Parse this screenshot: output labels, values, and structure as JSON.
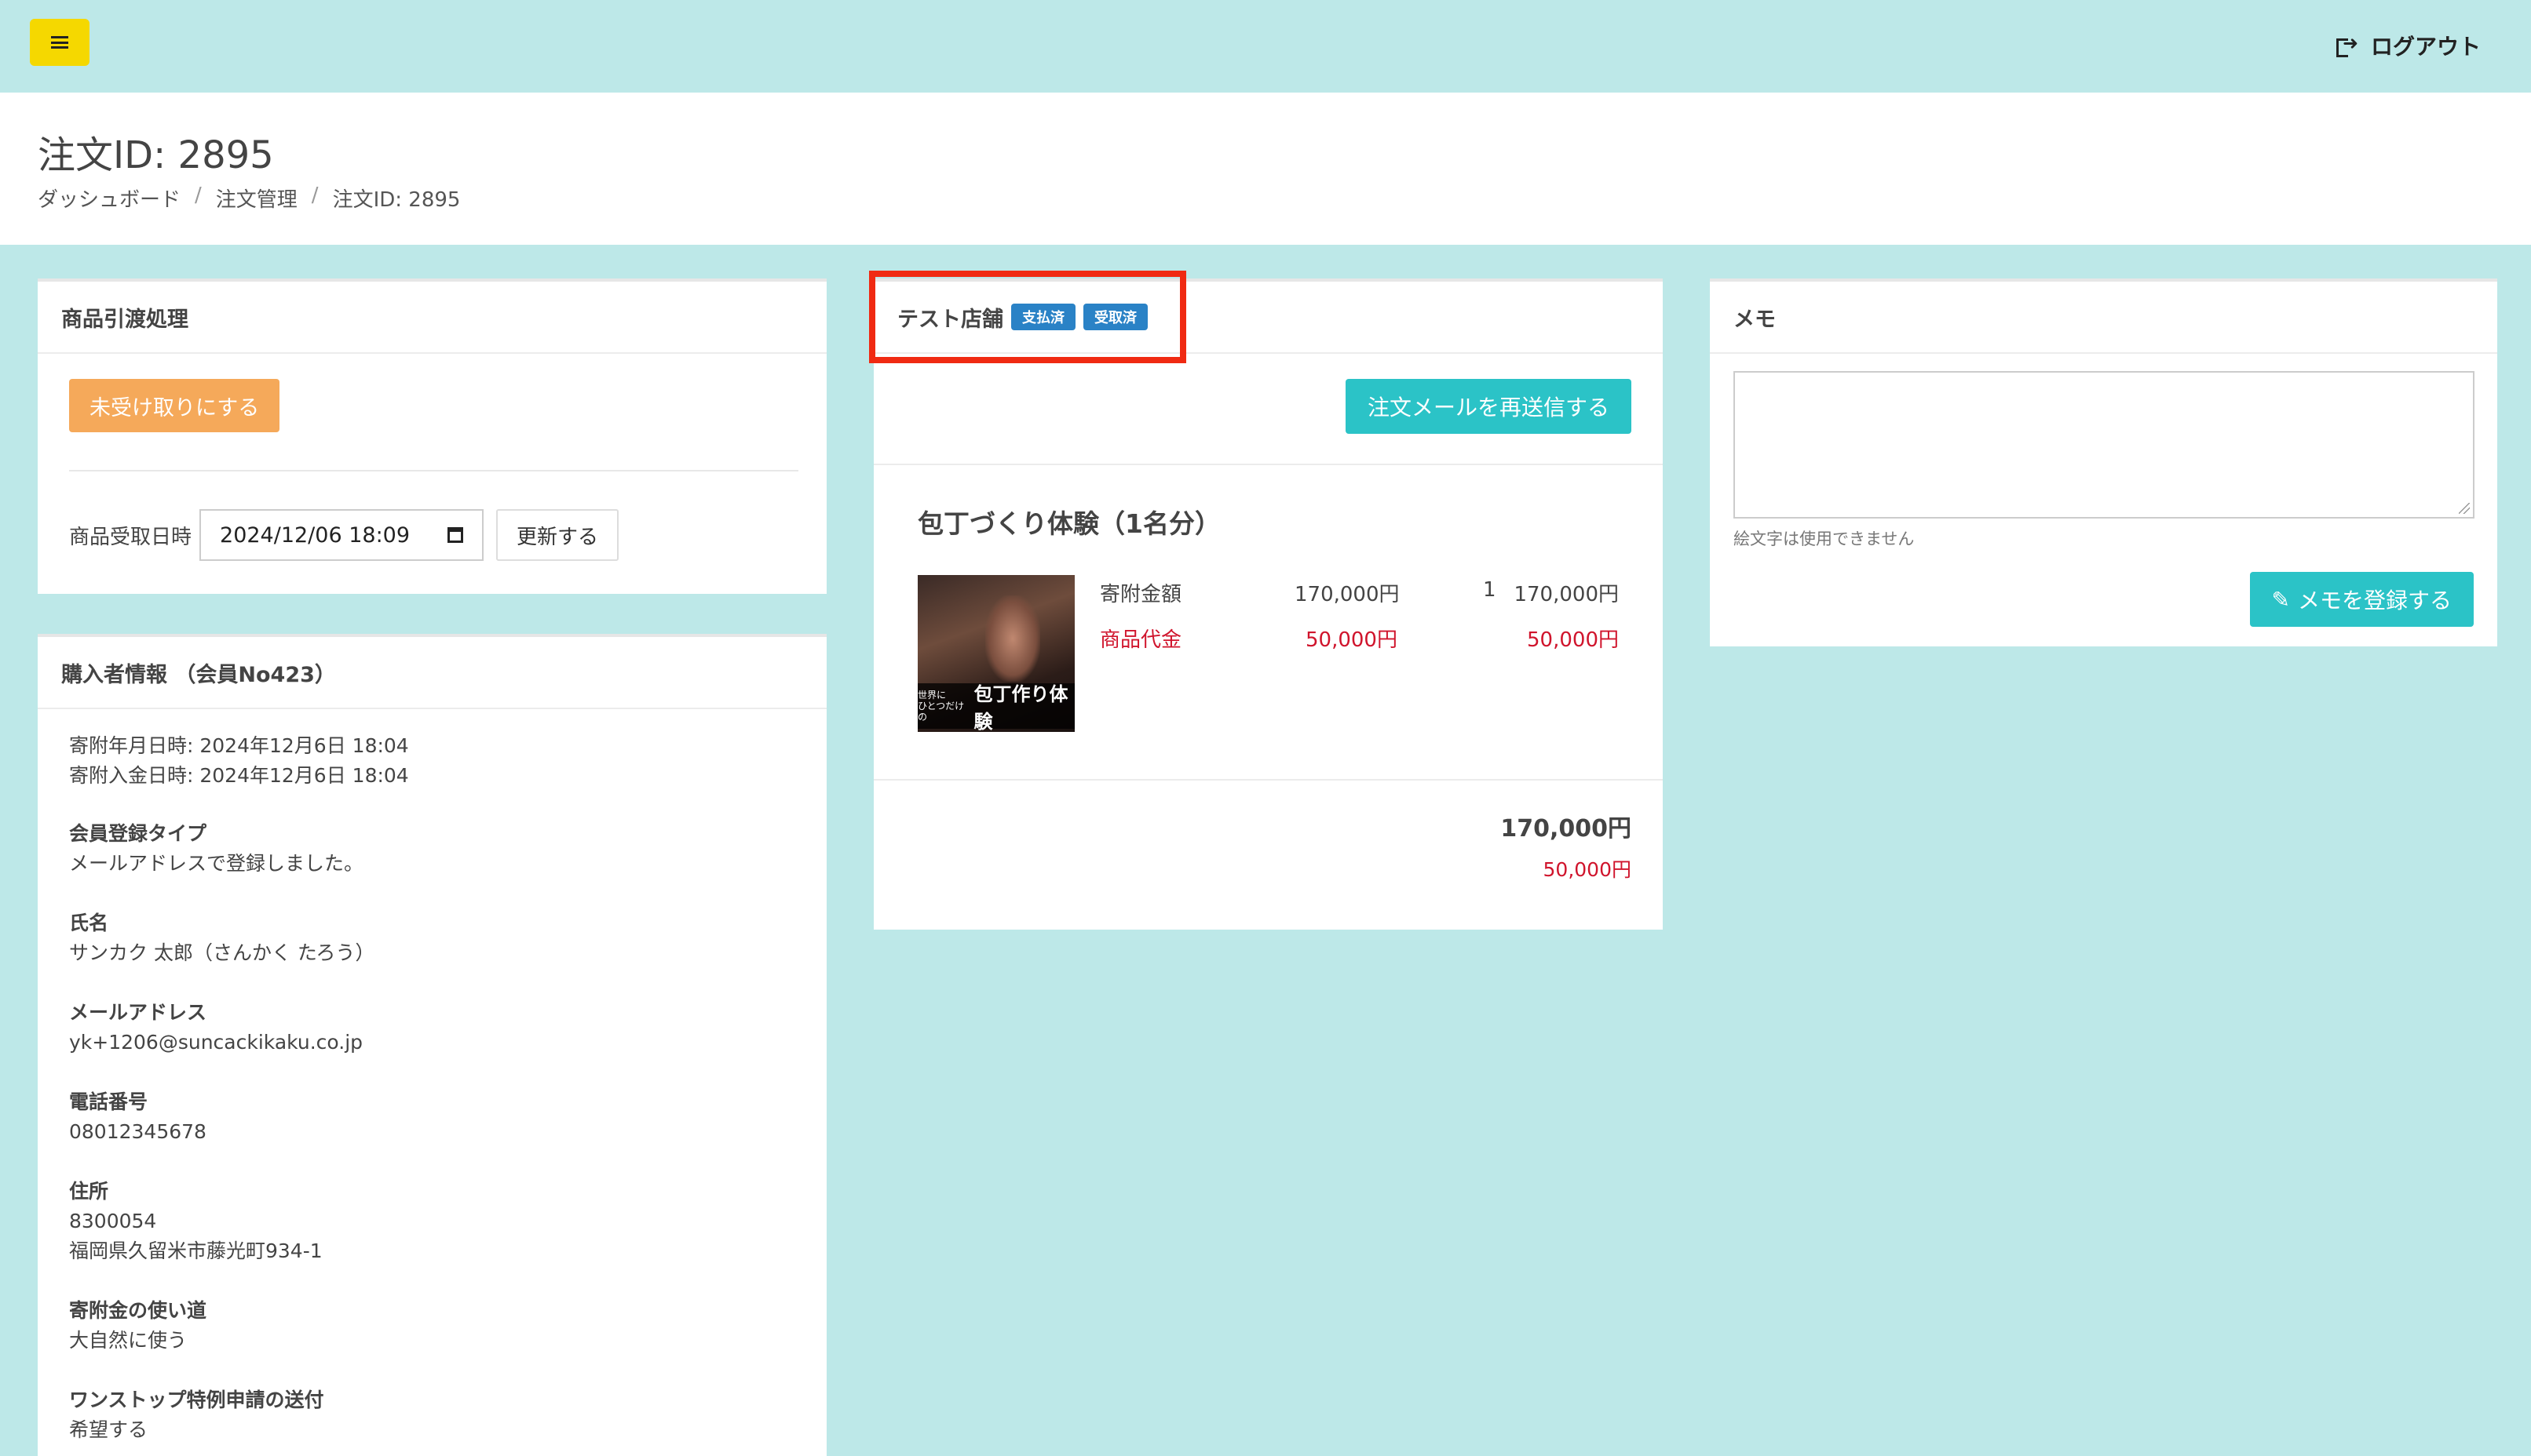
{
  "topbar": {
    "logout_label": "ログアウト"
  },
  "header": {
    "title": "注文ID: 2895",
    "breadcrumb": [
      "ダッシュボード",
      "注文管理",
      "注文ID: 2895"
    ]
  },
  "handover": {
    "title": "商品引渡処理",
    "unreceive_button": "未受け取りにする",
    "date_label": "商品受取日時",
    "date_value": "2024/12/06 18:09",
    "update_button": "更新する"
  },
  "buyer": {
    "title": "購入者情報 （会員No423）",
    "donation_datetime": "寄附年月日時: 2024年12月6日 18:04",
    "payment_datetime": "寄附入金日時: 2024年12月6日 18:04",
    "fields": [
      {
        "label": "会員登録タイプ",
        "value": "メールアドレスで登録しました。"
      },
      {
        "label": "氏名",
        "value": "サンカク 太郎（さんかく たろう）"
      },
      {
        "label": "メールアドレス",
        "value": "yk+1206@suncackikaku.co.jp"
      },
      {
        "label": "電話番号",
        "value": "08012345678"
      },
      {
        "label": "住所",
        "value": "8300054",
        "value2": "福岡県久留米市藤光町934-1"
      },
      {
        "label": "寄附金の使い道",
        "value": "大自然に使う"
      },
      {
        "label": "ワンストップ特例申請の送付",
        "value": "希望する"
      }
    ]
  },
  "order": {
    "shop_name": "テスト店舗",
    "badges": [
      "支払済",
      "受取済"
    ],
    "resend_button": "注文メールを再送信する",
    "item_title": "包丁づくり体験（1名分）",
    "thumb_text_small1": "世界に",
    "thumb_text_small2": "ひとつだけの",
    "thumb_text_big": "包丁作り体験",
    "rows": [
      {
        "label": "寄附金額",
        "unit_price": "170,000円",
        "qty": "1",
        "subtotal": "170,000円"
      },
      {
        "label": "商品代金",
        "unit_price": "50,000円",
        "qty": "",
        "subtotal": "50,000円"
      }
    ],
    "total": "170,000円",
    "total_product": "50,000円",
    "colors": {
      "badge": "#2a82c6",
      "accent": "#2bc3c7",
      "red": "#d0142c",
      "highlight": "#f02a12"
    }
  },
  "memo": {
    "title": "メモ",
    "help": "絵文字は使用できません",
    "submit_button": "メモを登録する"
  }
}
